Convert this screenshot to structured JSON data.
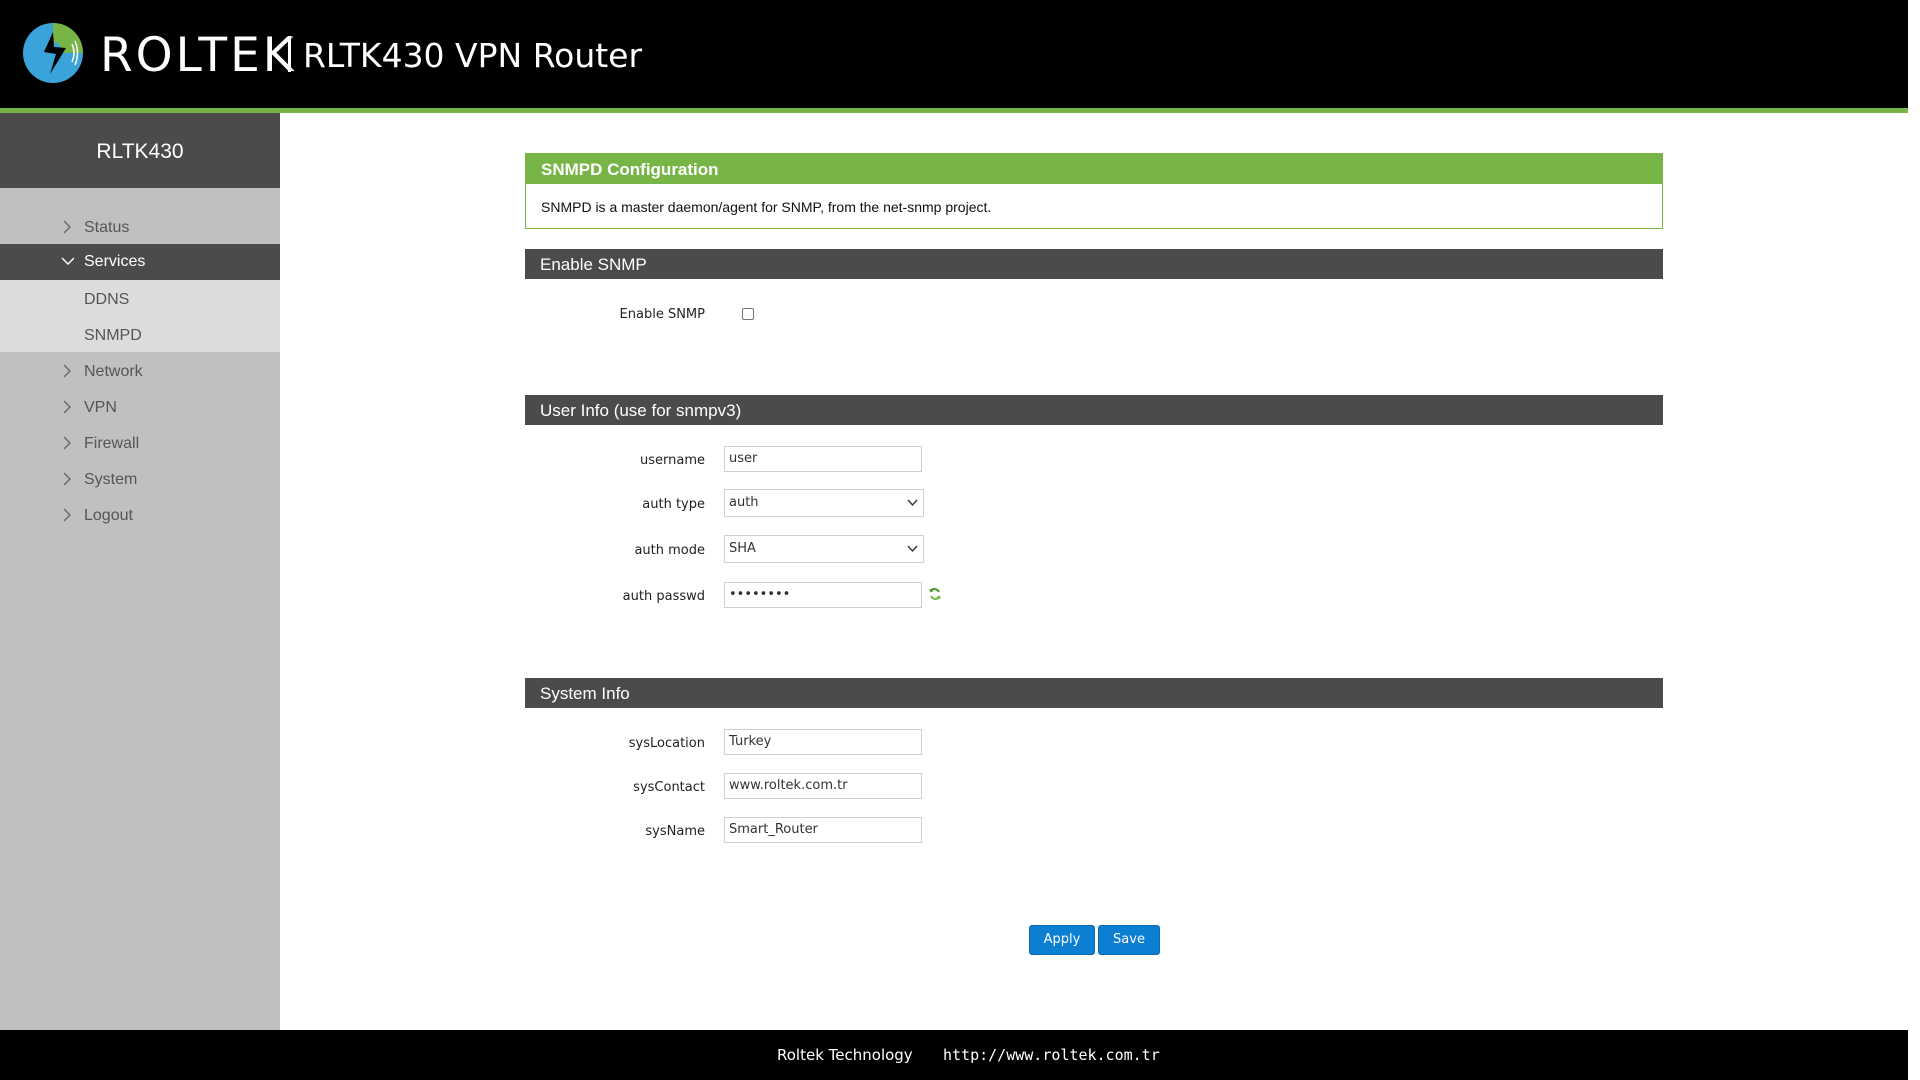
{
  "header": {
    "brand": "ROLTEK",
    "product_title": "RLTK430 VPN Router"
  },
  "sidebar": {
    "device_name": "RLTK430",
    "items": [
      {
        "label": "Status",
        "expanded": false
      },
      {
        "label": "Services",
        "expanded": true,
        "children": [
          {
            "label": "DDNS"
          },
          {
            "label": "SNMPD"
          }
        ]
      },
      {
        "label": "Network",
        "expanded": false
      },
      {
        "label": "VPN",
        "expanded": false
      },
      {
        "label": "Firewall",
        "expanded": false
      },
      {
        "label": "System",
        "expanded": false
      },
      {
        "label": "Logout",
        "expanded": false
      }
    ]
  },
  "config": {
    "title": "SNMPD Configuration",
    "description": "SNMPD is a master daemon/agent for SNMP, from the net-snmp project."
  },
  "enable_section": {
    "title": "Enable SNMP",
    "enable_label": "Enable SNMP",
    "enabled": false
  },
  "user_section": {
    "title": "User Info (use for snmpv3)",
    "username_label": "username",
    "username_value": "user",
    "auth_type_label": "auth type",
    "auth_type_value": "auth",
    "auth_mode_label": "auth mode",
    "auth_mode_value": "SHA",
    "auth_passwd_label": "auth passwd",
    "auth_passwd_value": "••••••••"
  },
  "system_section": {
    "title": "System Info",
    "location_label": "sysLocation",
    "location_value": "Turkey",
    "contact_label": "sysContact",
    "contact_value": "www.roltek.com.tr",
    "name_label": "sysName",
    "name_value": "Smart_Router"
  },
  "actions": {
    "apply_label": "Apply",
    "save_label": "Save"
  },
  "footer": {
    "company": "Roltek Technology",
    "url": "http://www.roltek.com.tr"
  },
  "colors": {
    "accent_green": "#77b547",
    "header_bg": "#000000",
    "section_bar": "#4b4b4b",
    "button_blue": "#0c7fd3",
    "logo_blue": "#3aa3d9"
  },
  "icons": {
    "logo": "roltek-logo-icon",
    "collapsed": "chevron-right-icon",
    "expanded": "chevron-down-icon",
    "reveal_password": "refresh-reveal-icon"
  }
}
